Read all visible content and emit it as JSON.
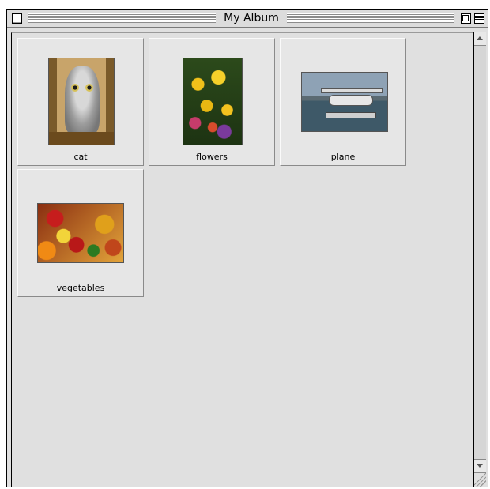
{
  "window": {
    "title": "My Album"
  },
  "album": {
    "items": [
      {
        "label": "cat"
      },
      {
        "label": "flowers"
      },
      {
        "label": "plane"
      },
      {
        "label": "vegetables"
      }
    ]
  },
  "icons": {
    "close": "close-box-icon",
    "zoom": "zoom-box-icon",
    "collapse": "collapse-box-icon",
    "scroll_up": "scroll-up-arrow-icon",
    "scroll_down": "scroll-down-arrow-icon",
    "resize": "resize-grip-icon"
  }
}
